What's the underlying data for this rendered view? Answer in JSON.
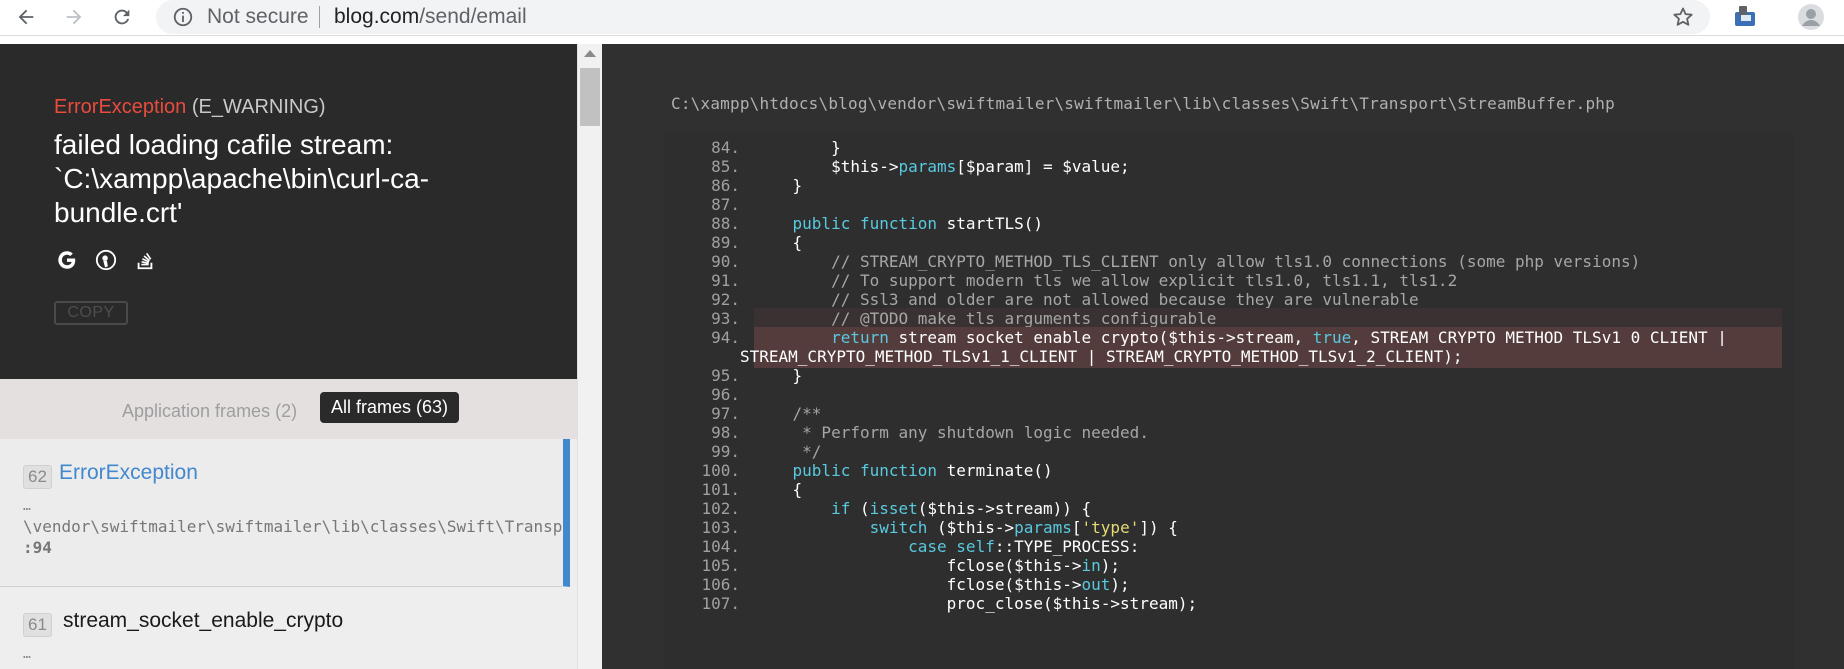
{
  "browser": {
    "security_label": "Not secure",
    "url_host": "blog.com",
    "url_path": "/send/email"
  },
  "exception": {
    "class_name": "ErrorException",
    "code": "(E_WARNING)",
    "message": "failed loading cafile stream: `C:\\xampp\\apache\\bin\\curl-ca-bundle.crt'",
    "search_icons": [
      "google-icon",
      "duckduckgo-icon",
      "stackoverflow-icon"
    ],
    "copy_label": "COPY"
  },
  "filters": {
    "application": "Application frames (2)",
    "all": "All frames (63)"
  },
  "frames": [
    {
      "index": "62",
      "name": "ErrorException",
      "ellipsis": "…",
      "file": "\\vendor\\swiftmailer\\swiftmailer\\lib\\classes\\Swift\\Transport\\StreamBuffer.php",
      "line": ":94"
    },
    {
      "index": "61",
      "name": "stream_socket_enable_crypto",
      "ellipsis": "…"
    }
  ],
  "code": {
    "file_path": "C:\\xampp\\htdocs\\blog\\vendor\\swiftmailer\\swiftmailer\\lib\\classes\\Swift\\Transport\\StreamBuffer.php",
    "lines": [
      {
        "n": "84.",
        "text": "        }"
      },
      {
        "n": "85.",
        "text": "        $this->params[$param] = $value;"
      },
      {
        "n": "86.",
        "text": "    }"
      },
      {
        "n": "87.",
        "text": ""
      },
      {
        "n": "88.",
        "text": "    public function startTLS()"
      },
      {
        "n": "89.",
        "text": "    {"
      },
      {
        "n": "90.",
        "text": "        // STREAM_CRYPTO_METHOD_TLS_CLIENT only allow tls1.0 connections (some php versions)"
      },
      {
        "n": "91.",
        "text": "        // To support modern tls we allow explicit tls1.0, tls1.1, tls1.2"
      },
      {
        "n": "92.",
        "text": "        // Ssl3 and older are not allowed because they are vulnerable"
      },
      {
        "n": "93.",
        "text": "        // @TODO make tls arguments configurable"
      },
      {
        "n": "94.",
        "text": "        return stream_socket_enable_crypto($this->stream, true, STREAM_CRYPTO_METHOD_TLSv1_0_CLIENT |"
      },
      {
        "n": "",
        "text": "STREAM_CRYPTO_METHOD_TLSv1_1_CLIENT | STREAM_CRYPTO_METHOD_TLSv1_2_CLIENT);"
      },
      {
        "n": "95.",
        "text": "    }"
      },
      {
        "n": "96.",
        "text": ""
      },
      {
        "n": "97.",
        "text": "    /**"
      },
      {
        "n": "98.",
        "text": "     * Perform any shutdown logic needed."
      },
      {
        "n": "99.",
        "text": "     */"
      },
      {
        "n": "100.",
        "text": "    public function terminate()"
      },
      {
        "n": "101.",
        "text": "    {"
      },
      {
        "n": "102.",
        "text": "        if (isset($this->stream)) {"
      },
      {
        "n": "103.",
        "text": "            switch ($this->params['type']) {"
      },
      {
        "n": "104.",
        "text": "                case self::TYPE_PROCESS:"
      },
      {
        "n": "105.",
        "text": "                    fclose($this->in);"
      },
      {
        "n": "106.",
        "text": "                    fclose($this->out);"
      },
      {
        "n": "107.",
        "text": "                    proc_close($this->stream);"
      }
    ]
  },
  "colors": {
    "exception_class": "#e94b3c",
    "active_frame_accent": "#4288ce",
    "keyword": "#59c9e0",
    "string": "#e6db74",
    "highlight_line": "#553c3c"
  }
}
